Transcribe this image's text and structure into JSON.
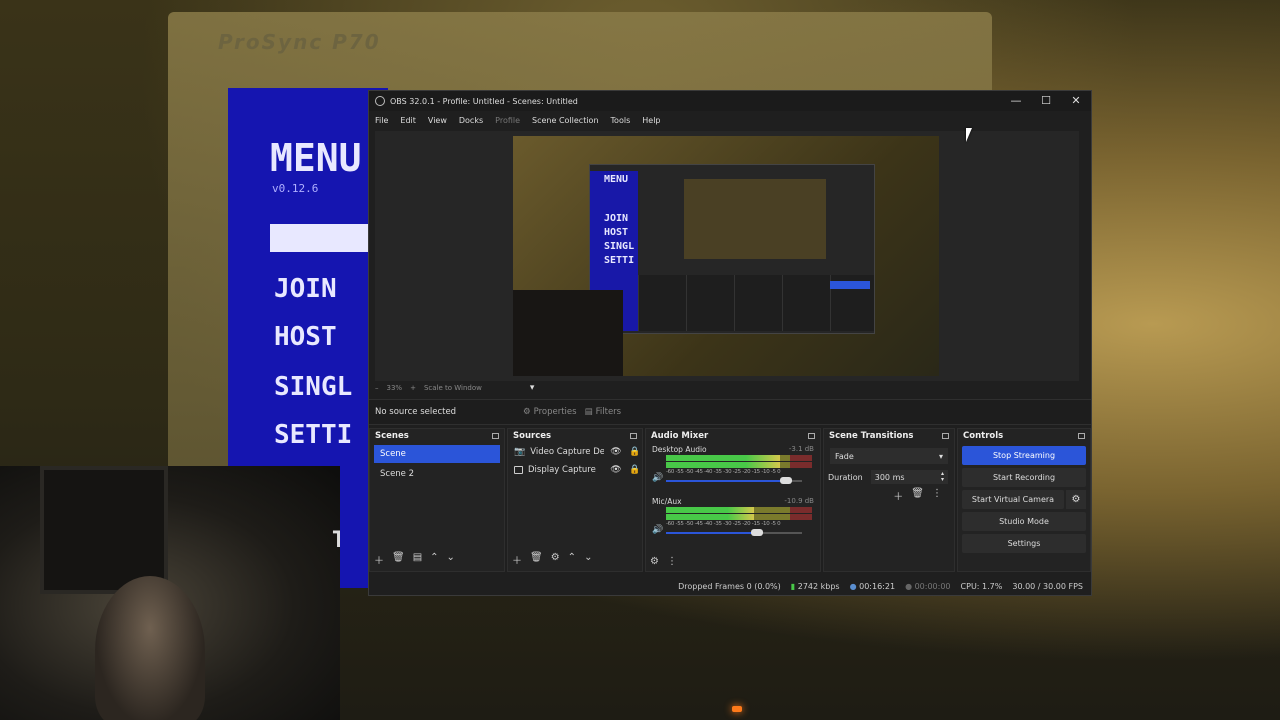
{
  "background": {
    "monitor_brand": "ProSync P70",
    "crt_menu": {
      "title": "MENU",
      "version": "v0.12.6",
      "items": [
        "JOIN",
        "HOST",
        "SINGL",
        "SETTI"
      ]
    },
    "webcam_caption": "T"
  },
  "window": {
    "title": "OBS 32.0.1 - Profile: Untitled - Scenes: Untitled",
    "controls": {
      "minimize": "—",
      "maximize": "☐",
      "close": "✕"
    }
  },
  "menubar": [
    "File",
    "Edit",
    "View",
    "Docks",
    "Profile",
    "Scene Collection",
    "Tools",
    "Help"
  ],
  "preview": {
    "nested_menu": [
      "MENU",
      "JOIN",
      "HOST",
      "SINGL",
      "SETTI"
    ],
    "zoom": "33%",
    "scale_mode": "Scale to Window"
  },
  "properties_bar": {
    "no_source": "No source selected",
    "properties": "Properties",
    "filters": "Filters"
  },
  "scenes": {
    "title": "Scenes",
    "items": [
      {
        "label": "Scene",
        "active": true
      },
      {
        "label": "Scene 2",
        "active": false
      }
    ]
  },
  "sources": {
    "title": "Sources",
    "items": [
      {
        "label": "Video Capture Dev",
        "icon": "camera-icon"
      },
      {
        "label": "Display Capture",
        "icon": "monitor-icon"
      }
    ]
  },
  "audio_mixer": {
    "title": "Audio Mixer",
    "channels": [
      {
        "name": "Desktop Audio",
        "db": "-3.1 dB",
        "meter_level": 0.78,
        "volume": 0.88
      },
      {
        "name": "Mic/Aux",
        "db": "-10.9 dB",
        "meter_level": 0.6,
        "volume": 0.67
      }
    ],
    "ticks": "-60 -55 -50 -45 -40 -35 -30 -25 -20 -15 -10 -5 0"
  },
  "transitions": {
    "title": "Scene Transitions",
    "selected": "Fade",
    "duration_label": "Duration",
    "duration_value": "300 ms"
  },
  "controls": {
    "title": "Controls",
    "stop_streaming": "Stop Streaming",
    "start_recording": "Start Recording",
    "start_virtual_camera": "Start Virtual Camera",
    "studio_mode": "Studio Mode",
    "settings": "Settings"
  },
  "statusbar": {
    "dropped_frames": "Dropped Frames 0 (0.0%)",
    "bitrate": "2742 kbps",
    "stream_time": "00:16:21",
    "record_time": "00:00:00",
    "cpu": "CPU: 1.7%",
    "fps": "30.00 / 30.00 FPS"
  },
  "colors": {
    "accent": "#2b55d9",
    "meter_green": "#48c848",
    "crt_blue": "#1515b0"
  }
}
